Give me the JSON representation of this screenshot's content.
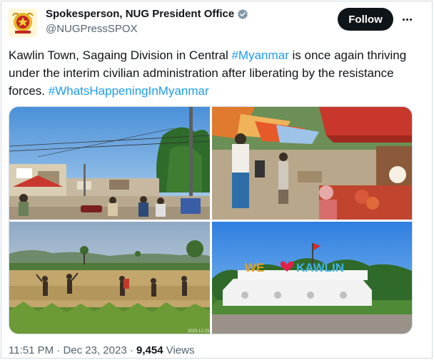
{
  "author": {
    "display_name": "Spokesperson, NUG President Office",
    "handle": "@NUGPressSPOX",
    "verified": true,
    "avatar_icon": "myanmar-emblem-icon"
  },
  "actions": {
    "follow_label": "Follow",
    "more_icon": "more-horizontal-icon"
  },
  "tweet": {
    "text_1": "Kawlin Town, Sagaing Division in Central ",
    "hashtag_1": "#Myanmar",
    "text_2": " is once again thriving under the interim civilian administration after liberating by the resistance forces. ",
    "hashtag_2": "#WhatsHappeningInMyanmar"
  },
  "media": {
    "photos": [
      {
        "subject": "street-scene"
      },
      {
        "subject": "market-stalls"
      },
      {
        "subject": "rice-field-workers",
        "stamp": "2023.12.23"
      },
      {
        "subject": "kawlin-sign",
        "sign_text_1": "WE",
        "sign_text_2": "KAWLIN"
      }
    ]
  },
  "meta": {
    "time": "11:51 PM",
    "separator": " · ",
    "date": "Dec 23, 2023",
    "views_count": "9,454",
    "views_label": " Views"
  },
  "colors": {
    "accent": "#1d9bf0",
    "text": "#0f1419",
    "muted": "#536471",
    "border": "#cfd9de"
  }
}
